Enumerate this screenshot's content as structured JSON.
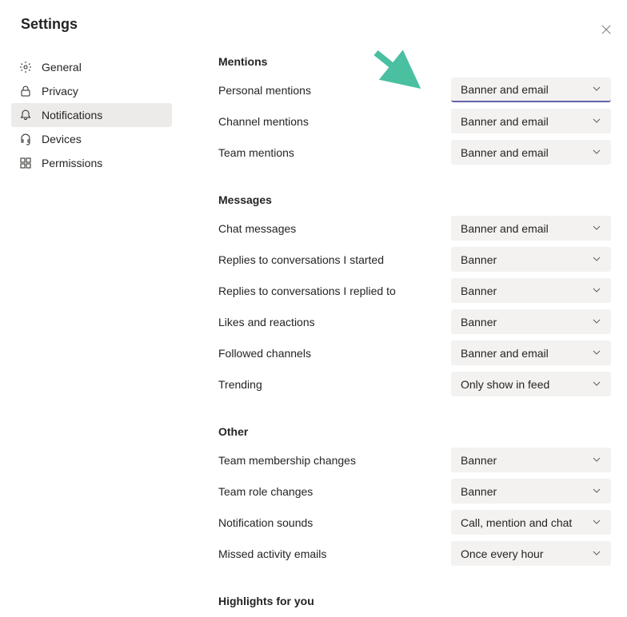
{
  "header": {
    "title": "Settings"
  },
  "sidebar": {
    "items": [
      {
        "label": "General",
        "icon": "gear"
      },
      {
        "label": "Privacy",
        "icon": "lock"
      },
      {
        "label": "Notifications",
        "icon": "bell",
        "active": true
      },
      {
        "label": "Devices",
        "icon": "headset"
      },
      {
        "label": "Permissions",
        "icon": "apps"
      }
    ]
  },
  "sections": {
    "mentions": {
      "title": "Mentions",
      "rows": [
        {
          "label": "Personal mentions",
          "value": "Banner and email",
          "highlighted": true
        },
        {
          "label": "Channel mentions",
          "value": "Banner and email"
        },
        {
          "label": "Team mentions",
          "value": "Banner and email"
        }
      ]
    },
    "messages": {
      "title": "Messages",
      "rows": [
        {
          "label": "Chat messages",
          "value": "Banner and email"
        },
        {
          "label": "Replies to conversations I started",
          "value": "Banner"
        },
        {
          "label": "Replies to conversations I replied to",
          "value": "Banner"
        },
        {
          "label": "Likes and reactions",
          "value": "Banner"
        },
        {
          "label": "Followed channels",
          "value": "Banner and email"
        },
        {
          "label": "Trending",
          "value": "Only show in feed"
        }
      ]
    },
    "other": {
      "title": "Other",
      "rows": [
        {
          "label": "Team membership changes",
          "value": "Banner"
        },
        {
          "label": "Team role changes",
          "value": "Banner"
        },
        {
          "label": "Notification sounds",
          "value": "Call, mention and chat"
        },
        {
          "label": "Missed activity emails",
          "value": "Once every hour"
        }
      ]
    },
    "highlights": {
      "title": "Highlights for you"
    }
  },
  "annotation": {
    "arrow_color": "#4ac0a1"
  }
}
